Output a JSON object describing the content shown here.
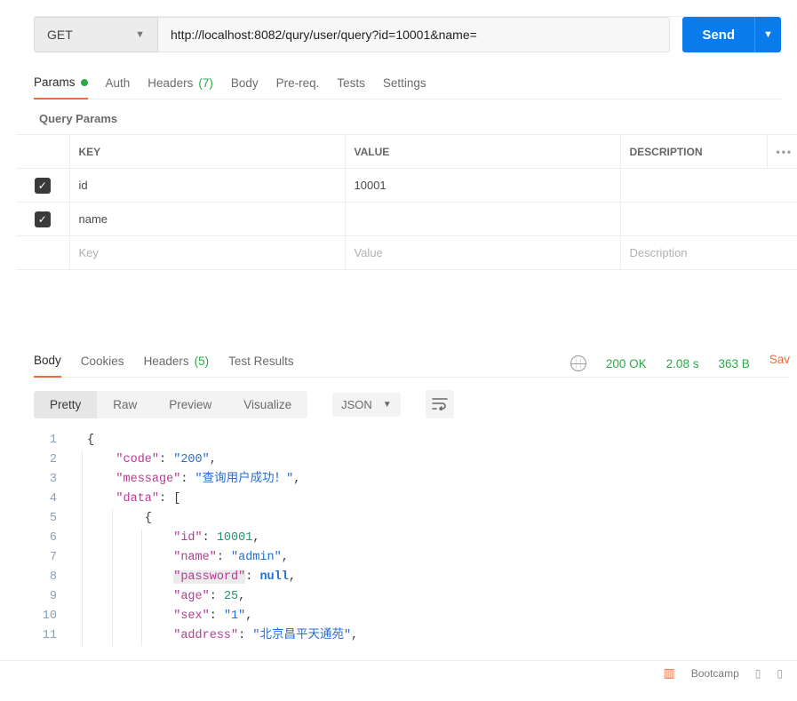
{
  "request": {
    "method": "GET",
    "url": "http://localhost:8082/qury/user/query?id=10001&name=",
    "send": "Send"
  },
  "req_tabs": {
    "params": "Params",
    "auth": "Auth",
    "headers_label": "Headers",
    "headers_count": "(7)",
    "body": "Body",
    "prereq": "Pre-req.",
    "tests": "Tests",
    "settings": "Settings"
  },
  "qp": {
    "title": "Query Params",
    "cols": {
      "key": "KEY",
      "value": "VALUE",
      "desc": "DESCRIPTION"
    },
    "rows": [
      {
        "checked": true,
        "key": "id",
        "value": "10001",
        "desc": ""
      },
      {
        "checked": true,
        "key": "name",
        "value": "",
        "desc": ""
      }
    ],
    "placeholders": {
      "key": "Key",
      "value": "Value",
      "desc": "Description"
    }
  },
  "resp_tabs": {
    "body": "Body",
    "cookies": "Cookies",
    "headers_label": "Headers",
    "headers_count": "(5)",
    "tests": "Test Results",
    "status": "200 OK",
    "time": "2.08 s",
    "size": "363 B",
    "save": "Sav"
  },
  "resp_toolbar": {
    "pretty": "Pretty",
    "raw": "Raw",
    "preview": "Preview",
    "visualize": "Visualize",
    "format": "JSON"
  },
  "code": {
    "l1": "{",
    "l2": {
      "k": "\"code\"",
      "c": ": ",
      "v": "\"200\"",
      "e": ","
    },
    "l3": {
      "k": "\"message\"",
      "c": ": ",
      "v": "\"查询用户成功！\"",
      "e": ","
    },
    "l4": {
      "k": "\"data\"",
      "c": ": [",
      "e": ""
    },
    "l5": "{",
    "l6": {
      "k": "\"id\"",
      "c": ": ",
      "v": "10001",
      "e": ","
    },
    "l7": {
      "k": "\"name\"",
      "c": ": ",
      "v": "\"admin\"",
      "e": ","
    },
    "l8": {
      "k": "\"password\"",
      "c": ": ",
      "v": "null",
      "e": ","
    },
    "l9": {
      "k": "\"age\"",
      "c": ": ",
      "v": "25",
      "e": ","
    },
    "l10": {
      "k": "\"sex\"",
      "c": ": ",
      "v": "\"1\"",
      "e": ","
    },
    "l11": {
      "k": "\"address\"",
      "c": ": ",
      "v": "\"北京昌平天通苑\"",
      "e": ","
    }
  },
  "bottom": {
    "bootcamp": "Bootcamp"
  }
}
